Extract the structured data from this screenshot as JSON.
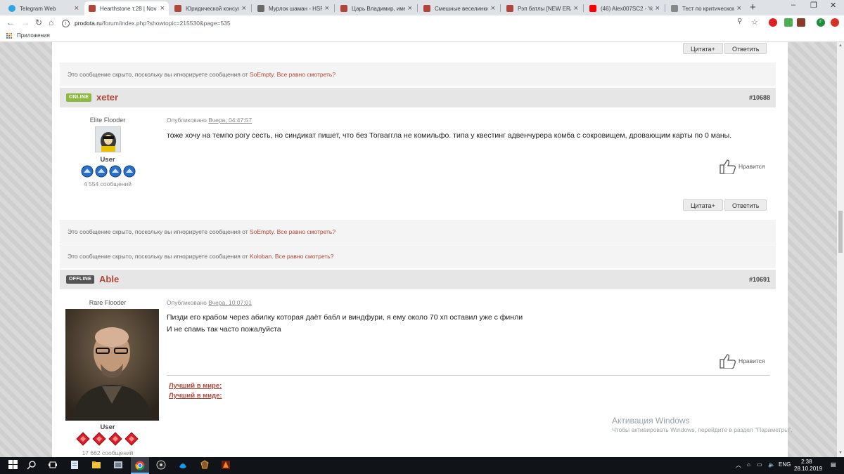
{
  "browser": {
    "tabs": [
      {
        "title": "Telegram Web",
        "color": "#2ca5e0",
        "active": false
      },
      {
        "title": "Hearthstone т.28 | Nov",
        "color": "#b0463a",
        "active": true
      },
      {
        "title": "Юридической консуль",
        "color": "#b0463a",
        "active": false
      },
      {
        "title": "Мурлок шаман - HSRe",
        "color": "#6a6a6a",
        "active": false
      },
      {
        "title": "Царь Владимир, имен",
        "color": "#b0463a",
        "active": false
      },
      {
        "title": "Смешные веселинки",
        "color": "#b0463a",
        "active": false
      },
      {
        "title": "Рэп батлы [NEW ERA",
        "color": "#b0463a",
        "active": false
      },
      {
        "title": "(46) Alex007SC2 - YouT",
        "color": "#ff0000",
        "active": false
      },
      {
        "title": "Тест по критическому",
        "color": "#888888",
        "active": false
      }
    ],
    "new_tab": "+",
    "url_host": "prodota.ru",
    "url_rest": "/forum/index.php?showtopic=215530&page=535",
    "apps_label": "Приложения",
    "window_controls": {
      "minimize": "–",
      "maximize": "❐",
      "close": "✕"
    }
  },
  "forum": {
    "quote_label": "Цитата+",
    "reply_label": "Ответить",
    "hidden_prefix": "Это сообщение скрыто, поскольку вы игнорируете сообщения от",
    "show_anyway": "Все равно смотреть?",
    "like_label": "Нравится",
    "published_label": "Опубликовано",
    "hidden_1_user": "SoEmpty",
    "hidden_2_user": "SoEmpty",
    "hidden_3_user": "Koloban",
    "posts": [
      {
        "status": "ONLINE",
        "username": "xeter",
        "post_number": "#10688",
        "rank": "Elite Flooder",
        "group": "User",
        "message_count": "4 554 сообщений",
        "published": "Вчера, 04:47:57",
        "text": "тоже хочу на темпо рогу сесть, но синдикат пишет, что без Тогваггла не комильфо. типа у квестинг адвенчурера комба с сокровищем, дровающим карты по 0 маны."
      },
      {
        "status": "OFFLINE",
        "username": "Able",
        "post_number": "#10691",
        "rank": "Rare Flooder",
        "group": "User",
        "message_count": "17 662 сообщений",
        "published": "Вчера, 10:07:01",
        "text_line1": "Пизди его крабом через абилку которая даёт бабл и виндфури, я ему около 70 хп оставил уже с финли",
        "text_line2": "И не спамь так часто пожалуйста",
        "signature_1": "Лучший в мире:",
        "signature_2": "Лучший в миде:"
      }
    ]
  },
  "watermark": {
    "title": "Активация Windows",
    "subtitle": "Чтобы активировать Windows, перейдите в раздел \"Параметры\"."
  },
  "taskbar": {
    "lang": "ENG",
    "time": "2:38",
    "date": "28.10.2019"
  }
}
